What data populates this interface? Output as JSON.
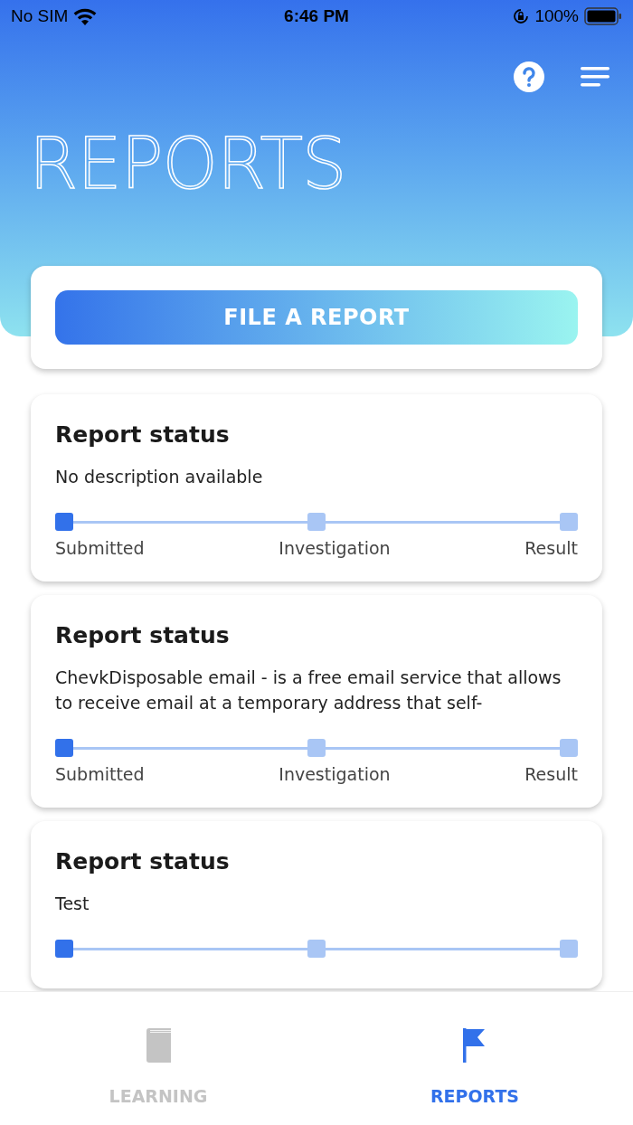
{
  "status_bar": {
    "carrier": "No SIM",
    "time": "6:46 PM",
    "battery": "100%"
  },
  "header": {
    "title": "REPORTS"
  },
  "file_button": "FILE A REPORT",
  "reports": [
    {
      "title": "Report status",
      "description": "No description available",
      "steps": [
        {
          "label": "Submitted",
          "reached": true
        },
        {
          "label": "Investigation",
          "reached": false
        },
        {
          "label": "Result",
          "reached": false
        }
      ]
    },
    {
      "title": "Report status",
      "description": "ChevkDisposable email - is a free email service that allows to receive email at a temporary address that self-",
      "steps": [
        {
          "label": "Submitted",
          "reached": true
        },
        {
          "label": "Investigation",
          "reached": false
        },
        {
          "label": "Result",
          "reached": false
        }
      ]
    },
    {
      "title": "Report status",
      "description": "Test",
      "steps": [
        {
          "reached": true
        },
        {
          "reached": false
        },
        {
          "reached": false
        }
      ]
    }
  ],
  "tabs": [
    {
      "label": "LEARNING",
      "kind": "book",
      "selected": false
    },
    {
      "label": "REPORTS",
      "kind": "flag",
      "selected": true
    }
  ]
}
